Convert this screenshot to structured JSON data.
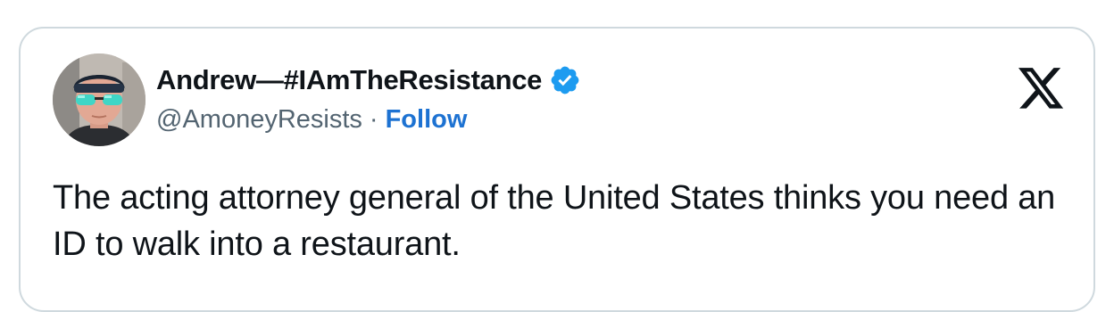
{
  "tweet": {
    "author": {
      "display_name": "Andrew—#IAmTheResistance",
      "handle": "@AmoneyResists",
      "separator": "·",
      "follow_label": "Follow",
      "verified": true
    },
    "platform_icon": "x-logo-icon",
    "text": "The acting attorney general of the United States thinks you need an ID to walk into a restaurant."
  },
  "colors": {
    "border": "#cfd9de",
    "text_primary": "#0f1419",
    "text_secondary": "#536471",
    "accent": "#1d72d2",
    "verified_badge": "#1d9bf0"
  }
}
